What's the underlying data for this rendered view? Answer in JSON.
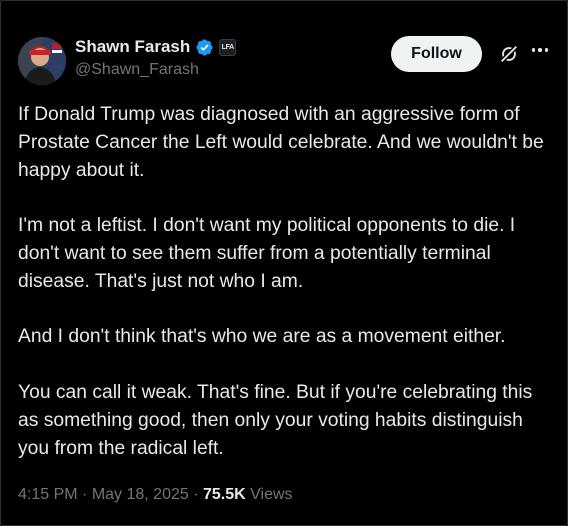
{
  "author": {
    "name": "Shawn Farash",
    "handle": "@Shawn_Farash",
    "affiliate_badge": "LFA"
  },
  "actions": {
    "follow_label": "Follow"
  },
  "post": {
    "paragraphs": [
      "If Donald Trump was diagnosed with an aggressive form of Prostate Cancer the Left would celebrate. And we wouldn't be happy about it.",
      "I'm not a leftist. I don't want my political opponents to die. I don't want to see them suffer from a potentially terminal disease. That's just not who I am.",
      "And I don't think that's who we are as a movement either.",
      "You can call it weak. That's fine. But if you're celebrating this as something good, then only your voting habits distinguish you from the radical left."
    ]
  },
  "meta": {
    "time": "4:15 PM",
    "date": "May 18, 2025",
    "separator": " · ",
    "views_count": "75.5K",
    "views_label": "Views"
  },
  "icons": {
    "verified": "verified-badge-icon",
    "grok": "grok-icon",
    "more": "more-icon"
  },
  "colors": {
    "background": "#000000",
    "text": "#e7e9ea",
    "secondary": "#71767b",
    "verified_blue": "#1d9bf0",
    "follow_bg": "#eff3f4"
  }
}
